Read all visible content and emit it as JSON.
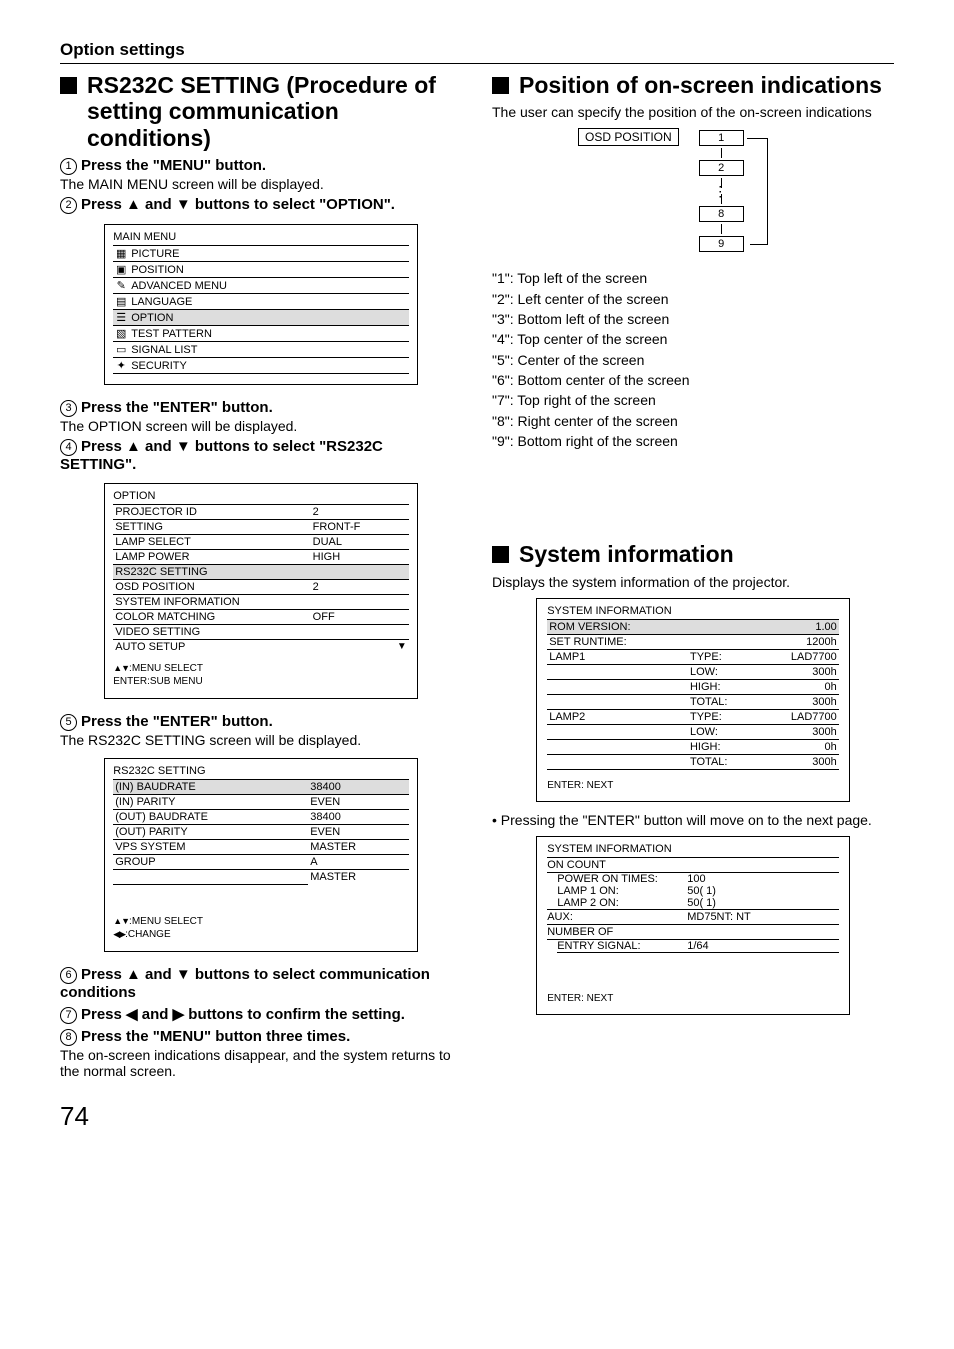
{
  "pageNumber": "74",
  "topHeading": "Option settings",
  "left": {
    "title": "RS232C SETTING (Procedure of setting communication conditions)",
    "steps": {
      "s1h": "Press the \"MENU\" button.",
      "s1s": "The MAIN MENU screen will be displayed.",
      "s2h": "Press ▲ and ▼ buttons to select \"OPTION\".",
      "s3h": "Press the \"ENTER\" button.",
      "s3s": "The OPTION screen will be displayed.",
      "s4h": "Press ▲ and ▼ buttons to select \"RS232C SETTING\".",
      "s5h": "Press the \"ENTER\" button.",
      "s5s": "The RS232C SETTING screen will be displayed.",
      "s6h": "Press ▲ and ▼ buttons to select communication conditions",
      "s7h": "Press ◀ and ▶ buttons to confirm the setting.",
      "s8h": "Press the \"MENU\" button three times.",
      "s8s": "The on-screen indications disappear, and the system returns to the normal screen."
    },
    "mainMenu": {
      "title": "MAIN MENU",
      "items": [
        "PICTURE",
        "POSITION",
        "ADVANCED MENU",
        "LANGUAGE",
        "OPTION",
        "TEST PATTERN",
        "SIGNAL LIST",
        "SECURITY"
      ]
    },
    "optionMenu": {
      "title": "OPTION",
      "rows": [
        {
          "k": "PROJECTOR ID",
          "v": "2"
        },
        {
          "k": "SETTING",
          "v": "FRONT-F"
        },
        {
          "k": "LAMP SELECT",
          "v": "DUAL"
        },
        {
          "k": "LAMP POWER",
          "v": "HIGH"
        },
        {
          "k": "RS232C SETTING",
          "v": ""
        },
        {
          "k": "OSD POSITION",
          "v": "2"
        },
        {
          "k": "SYSTEM INFORMATION",
          "v": ""
        },
        {
          "k": "COLOR MATCHING",
          "v": "OFF"
        },
        {
          "k": "VIDEO SETTING",
          "v": ""
        },
        {
          "k": "AUTO SETUP",
          "v": ""
        }
      ],
      "hint1": ":MENU SELECT",
      "hint2": "ENTER:SUB MENU"
    },
    "rsMenu": {
      "title": "RS232C SETTING",
      "rows": [
        {
          "k": "(IN) BAUDRATE",
          "v": "38400"
        },
        {
          "k": "(IN) PARITY",
          "v": "EVEN"
        },
        {
          "k": "(OUT) BAUDRATE",
          "v": "38400"
        },
        {
          "k": "(OUT) PARITY",
          "v": "EVEN"
        },
        {
          "k": "VPS SYSTEM",
          "v": "MASTER"
        },
        {
          "k": "GROUP",
          "v": "A"
        },
        {
          "k": "",
          "v": "MASTER"
        }
      ],
      "hint1": ":MENU SELECT",
      "hint2": ":CHANGE"
    }
  },
  "right": {
    "posTitle": "Position of on-screen indications",
    "posLead": "The user can specify the position of the on-screen indications",
    "osdLabel": "OSD POSITION",
    "osdVals": [
      "1",
      "2",
      "8",
      "9"
    ],
    "posList": [
      "\"1\": Top left of the screen",
      "\"2\": Left center of the screen",
      "\"3\": Bottom left of the screen",
      "\"4\": Top center of the screen",
      "\"5\": Center of the screen",
      "\"6\": Bottom center of the screen",
      "\"7\": Top right of the screen",
      "\"8\": Right center of the screen",
      "\"9\": Bottom right of the screen"
    ],
    "sysTitle": "System information",
    "sysLead": "Displays the system information of the projector.",
    "sys1": {
      "title": "SYSTEM INFORMATION",
      "rows": [
        {
          "a": "ROM VERSION:",
          "b": "",
          "c": "1.00"
        },
        {
          "a": "SET RUNTIME:",
          "b": "",
          "c": "1200h"
        },
        {
          "a": "LAMP1",
          "b": "TYPE:",
          "c": "LAD7700"
        },
        {
          "a": "",
          "b": "LOW:",
          "c": "300h"
        },
        {
          "a": "",
          "b": "HIGH:",
          "c": "0h"
        },
        {
          "a": "",
          "b": "TOTAL:",
          "c": "300h"
        },
        {
          "a": "LAMP2",
          "b": "TYPE:",
          "c": "LAD7700"
        },
        {
          "a": "",
          "b": "LOW:",
          "c": "300h"
        },
        {
          "a": "",
          "b": "HIGH:",
          "c": "0h"
        },
        {
          "a": "",
          "b": "TOTAL:",
          "c": "300h"
        }
      ],
      "next": "ENTER: NEXT"
    },
    "note": "• Pressing the \"ENTER\" button will move on to the next page.",
    "sys2": {
      "title": "SYSTEM INFORMATION",
      "cat1": "ON COUNT",
      "l1": "POWER ON TIMES:",
      "v1": "100",
      "l2": "LAMP 1 ON:",
      "v2": "50(  1)",
      "l3": "LAMP 2 ON:",
      "v3": "50(  1)",
      "aux": "AUX:",
      "auxv": "MD75NT: NT",
      "cat2": "NUMBER OF",
      "l4": "ENTRY SIGNAL:",
      "v4": "1/64",
      "next": "ENTER: NEXT"
    }
  }
}
